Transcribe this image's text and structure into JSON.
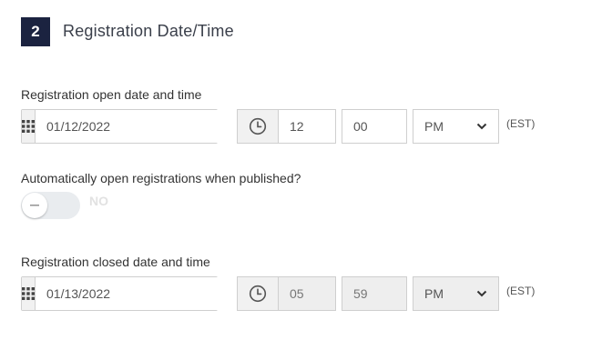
{
  "section": {
    "step": "2",
    "title": "Registration Date/Time"
  },
  "open": {
    "label": "Registration open date and time",
    "date": "01/12/2022",
    "hour": "12",
    "minute": "00",
    "ampm": "PM",
    "timezone": "(EST)"
  },
  "auto_open": {
    "label": "Automatically open registrations when published?",
    "toggle_text": "NO",
    "enabled": false
  },
  "closed": {
    "label": "Registration closed date and time",
    "date": "01/13/2022",
    "hour": "05",
    "minute": "59",
    "ampm": "PM",
    "timezone": "(EST)"
  },
  "colors": {
    "badge_bg": "#1b2340",
    "addon_bg": "#f1f1f1",
    "disabled_bg": "#eeeeee",
    "toggle_bg": "#e9ecef"
  },
  "icons": {
    "calendar": "calendar-grid-icon",
    "clock": "clock-icon",
    "dropdown": "chevron-down-icon"
  }
}
